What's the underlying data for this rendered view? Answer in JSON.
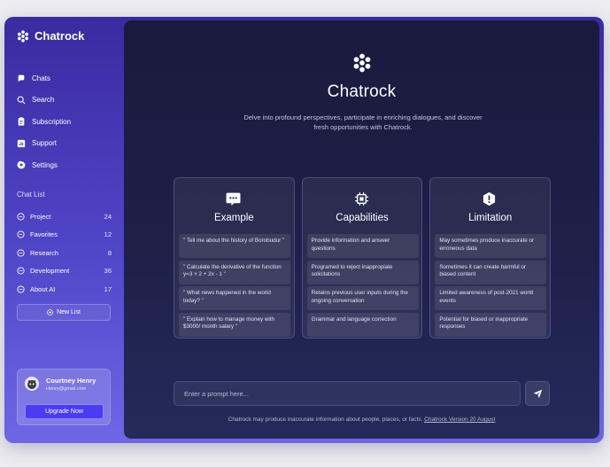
{
  "app": {
    "name": "Chatrock"
  },
  "sidebar": {
    "nav": [
      {
        "label": "Chats",
        "icon": "chat-icon"
      },
      {
        "label": "Search",
        "icon": "search-icon"
      },
      {
        "label": "Subscription",
        "icon": "clipboard-icon"
      },
      {
        "label": "Support",
        "icon": "chart-icon"
      },
      {
        "label": "Settings",
        "icon": "gear-icon"
      }
    ],
    "chat_list_title": "Chat List",
    "chat_list": [
      {
        "label": "Project",
        "count": "24"
      },
      {
        "label": "Favorites",
        "count": "12"
      },
      {
        "label": "Research",
        "count": "8"
      },
      {
        "label": "Development",
        "count": "36"
      },
      {
        "label": "About AI",
        "count": "17"
      }
    ],
    "new_list_label": "New List",
    "profile": {
      "name": "Courtney Henry",
      "email": "Henry@gmail.com",
      "upgrade_label": "Upgrade Now"
    }
  },
  "main": {
    "title": "Chatrock",
    "subtitle": "Delve into profound perspectives, participate in enriching dialogues, and discover fresh opportunities with Chatrock.",
    "cards": [
      {
        "title": "Example",
        "icon": "speech-bubble-icon",
        "rows": [
          "\" Tell me about the history of Borobudur \"",
          "\" Calculate the derivative of the function y=3 × 2 + 2x - 1 \"",
          "\" What news happened in the world today? \"",
          "\" Explain how to manage money with $3000/ month salary \""
        ]
      },
      {
        "title": "Capabilities",
        "icon": "chip-icon",
        "rows": [
          "Provide information and answer questions",
          "Programed to reject inappropiate solicitations",
          "Retains previous user inputs during the ongoing conversation",
          "Grammar and language correction"
        ]
      },
      {
        "title": "Limitation",
        "icon": "warning-icon",
        "rows": [
          "May sometimes produce inaccurate or erroneous data",
          "Sometimes it can create harmful or biased content",
          "Limited awareness of post-2021 world events",
          "Potential for biased or inappropriate responses"
        ]
      }
    ],
    "prompt_placeholder": "Enter a prompt here...",
    "footer_text": "Chatrock may produce inaccurate information about people, places, or facts.",
    "footer_link": "Chatrock Version 20 August"
  },
  "colors": {
    "accent": "#4a3cf5",
    "sidebar_top": "#3b2aa0",
    "main_bg": "#1a1a3d"
  }
}
